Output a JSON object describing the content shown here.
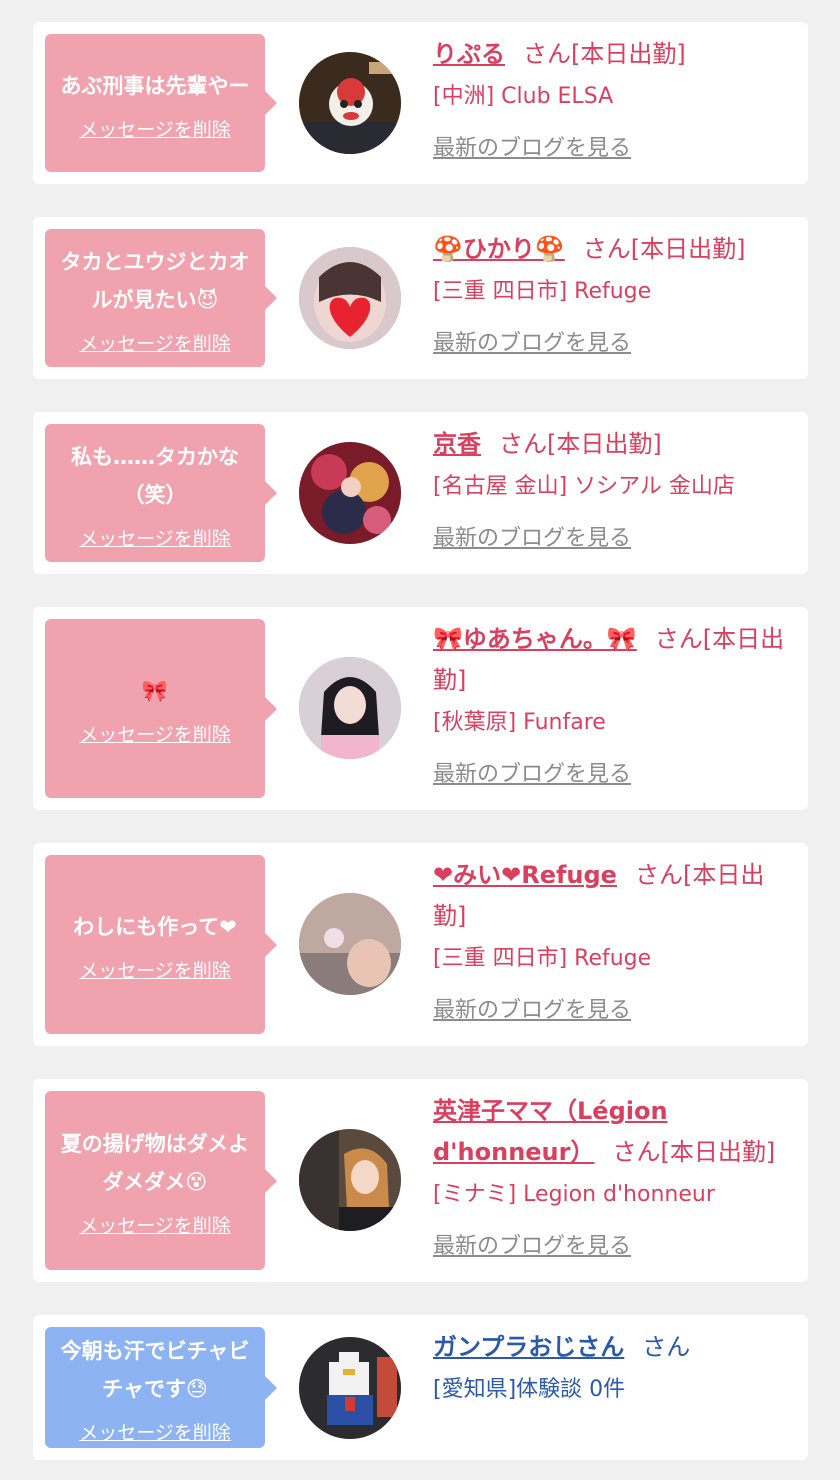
{
  "cards": [
    {
      "message": "あぶ刑事は先輩やー",
      "delete_label": "メッセージを削除",
      "name": "りぷる",
      "status": "さん[本日出勤]",
      "shop": "[中洲] Club ELSA",
      "blog_label": "最新のブログを見る",
      "theme": "pink"
    },
    {
      "message": "タカとユウジとカオルが見たい😈",
      "delete_label": "メッセージを削除",
      "name": "🍄ひかり🍄",
      "status": "さん[本日出勤]",
      "shop": "[三重 四日市] Refuge",
      "blog_label": "最新のブログを見る",
      "theme": "pink"
    },
    {
      "message": "私も……タカかな（笑）",
      "delete_label": "メッセージを削除",
      "name": "京香",
      "status": "さん[本日出勤]",
      "shop": "[名古屋 金山] ソシアル 金山店",
      "blog_label": "最新のブログを見る",
      "theme": "pink"
    },
    {
      "message": "🎀",
      "delete_label": "メッセージを削除",
      "name": "🎀ゆあちゃん。🎀",
      "status": "さん[本日出勤]",
      "shop": "[秋葉原] Funfare",
      "blog_label": "最新のブログを見る",
      "theme": "pink"
    },
    {
      "message": "わしにも作って❤",
      "delete_label": "メッセージを削除",
      "name": "❤みい❤Refuge",
      "status": "さん[本日出勤]",
      "shop": "[三重 四日市] Refuge",
      "blog_label": "最新のブログを見る",
      "theme": "pink"
    },
    {
      "message": "夏の揚げ物はダメよダメダメ😵",
      "delete_label": "メッセージを削除",
      "name": "英津子ママ（Légion d'honneur）",
      "status": "さん[本日出勤]",
      "shop": "[ミナミ] Legion d'honneur",
      "blog_label": "最新のブログを見る",
      "theme": "pink"
    },
    {
      "message": "今朝も汗でビチャビチャです😓",
      "delete_label": "メッセージを削除",
      "name": "ガンプラおじさん",
      "status": "さん",
      "shop": "[愛知県]体験談 0件",
      "blog_label": "",
      "theme": "blue"
    }
  ],
  "colors": {
    "pink_bubble": "#f0a3ae",
    "blue_bubble": "#8eb3f3",
    "name_pink": "#d9405f",
    "name_blue": "#2a5aa8",
    "blog_gray": "#8c8c8c",
    "background": "#f0f0f0"
  },
  "avatars": [
    "avatar-mask",
    "avatar-hikari",
    "avatar-kyoka",
    "avatar-yua",
    "avatar-mii",
    "avatar-etsuko",
    "avatar-gundam"
  ]
}
